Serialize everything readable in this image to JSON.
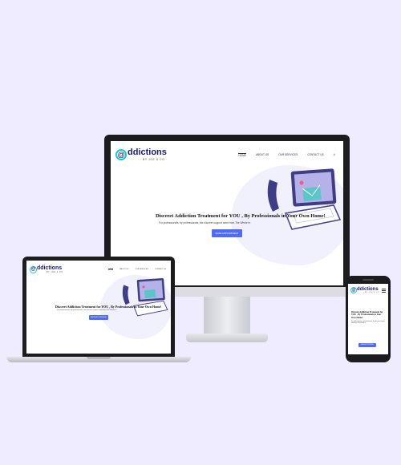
{
  "site": {
    "logo_letter": "@",
    "logo_name": "ddictions",
    "logo_tagline": "BY JOE & CO",
    "nav": [
      "HOME",
      "ABOUT US",
      "OUR SERVICES",
      "CONTACT US"
    ],
    "hero_title": "Discreet Addiction Treatment for YOU , By Professionals in Your Own Home!",
    "hero_sub": "For professionals, by professionals, the discreet support need from The Whole in.",
    "cta_label": "MAKE APPOINTMENT"
  },
  "colors": {
    "background": "#eeecfe",
    "brand_navy": "#1a1a6e",
    "brand_teal": "#1cc7d0",
    "cta_blue": "#4f6cf3",
    "illustration_purple": "#3e3d86"
  },
  "icons": [
    "search-icon",
    "phone-handset-icon",
    "laptop-illustration-icon",
    "email-envelope-icon",
    "menu-icon"
  ]
}
